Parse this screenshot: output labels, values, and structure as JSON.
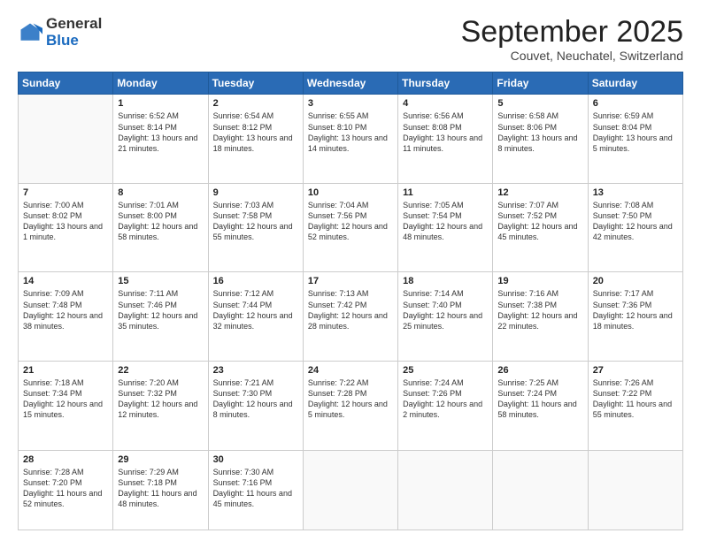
{
  "logo": {
    "general": "General",
    "blue": "Blue"
  },
  "title": "September 2025",
  "subtitle": "Couvet, Neuchatel, Switzerland",
  "weekdays": [
    "Sunday",
    "Monday",
    "Tuesday",
    "Wednesday",
    "Thursday",
    "Friday",
    "Saturday"
  ],
  "weeks": [
    [
      {
        "num": "",
        "info": ""
      },
      {
        "num": "1",
        "info": "Sunrise: 6:52 AM\nSunset: 8:14 PM\nDaylight: 13 hours\nand 21 minutes."
      },
      {
        "num": "2",
        "info": "Sunrise: 6:54 AM\nSunset: 8:12 PM\nDaylight: 13 hours\nand 18 minutes."
      },
      {
        "num": "3",
        "info": "Sunrise: 6:55 AM\nSunset: 8:10 PM\nDaylight: 13 hours\nand 14 minutes."
      },
      {
        "num": "4",
        "info": "Sunrise: 6:56 AM\nSunset: 8:08 PM\nDaylight: 13 hours\nand 11 minutes."
      },
      {
        "num": "5",
        "info": "Sunrise: 6:58 AM\nSunset: 8:06 PM\nDaylight: 13 hours\nand 8 minutes."
      },
      {
        "num": "6",
        "info": "Sunrise: 6:59 AM\nSunset: 8:04 PM\nDaylight: 13 hours\nand 5 minutes."
      }
    ],
    [
      {
        "num": "7",
        "info": "Sunrise: 7:00 AM\nSunset: 8:02 PM\nDaylight: 13 hours\nand 1 minute."
      },
      {
        "num": "8",
        "info": "Sunrise: 7:01 AM\nSunset: 8:00 PM\nDaylight: 12 hours\nand 58 minutes."
      },
      {
        "num": "9",
        "info": "Sunrise: 7:03 AM\nSunset: 7:58 PM\nDaylight: 12 hours\nand 55 minutes."
      },
      {
        "num": "10",
        "info": "Sunrise: 7:04 AM\nSunset: 7:56 PM\nDaylight: 12 hours\nand 52 minutes."
      },
      {
        "num": "11",
        "info": "Sunrise: 7:05 AM\nSunset: 7:54 PM\nDaylight: 12 hours\nand 48 minutes."
      },
      {
        "num": "12",
        "info": "Sunrise: 7:07 AM\nSunset: 7:52 PM\nDaylight: 12 hours\nand 45 minutes."
      },
      {
        "num": "13",
        "info": "Sunrise: 7:08 AM\nSunset: 7:50 PM\nDaylight: 12 hours\nand 42 minutes."
      }
    ],
    [
      {
        "num": "14",
        "info": "Sunrise: 7:09 AM\nSunset: 7:48 PM\nDaylight: 12 hours\nand 38 minutes."
      },
      {
        "num": "15",
        "info": "Sunrise: 7:11 AM\nSunset: 7:46 PM\nDaylight: 12 hours\nand 35 minutes."
      },
      {
        "num": "16",
        "info": "Sunrise: 7:12 AM\nSunset: 7:44 PM\nDaylight: 12 hours\nand 32 minutes."
      },
      {
        "num": "17",
        "info": "Sunrise: 7:13 AM\nSunset: 7:42 PM\nDaylight: 12 hours\nand 28 minutes."
      },
      {
        "num": "18",
        "info": "Sunrise: 7:14 AM\nSunset: 7:40 PM\nDaylight: 12 hours\nand 25 minutes."
      },
      {
        "num": "19",
        "info": "Sunrise: 7:16 AM\nSunset: 7:38 PM\nDaylight: 12 hours\nand 22 minutes."
      },
      {
        "num": "20",
        "info": "Sunrise: 7:17 AM\nSunset: 7:36 PM\nDaylight: 12 hours\nand 18 minutes."
      }
    ],
    [
      {
        "num": "21",
        "info": "Sunrise: 7:18 AM\nSunset: 7:34 PM\nDaylight: 12 hours\nand 15 minutes."
      },
      {
        "num": "22",
        "info": "Sunrise: 7:20 AM\nSunset: 7:32 PM\nDaylight: 12 hours\nand 12 minutes."
      },
      {
        "num": "23",
        "info": "Sunrise: 7:21 AM\nSunset: 7:30 PM\nDaylight: 12 hours\nand 8 minutes."
      },
      {
        "num": "24",
        "info": "Sunrise: 7:22 AM\nSunset: 7:28 PM\nDaylight: 12 hours\nand 5 minutes."
      },
      {
        "num": "25",
        "info": "Sunrise: 7:24 AM\nSunset: 7:26 PM\nDaylight: 12 hours\nand 2 minutes."
      },
      {
        "num": "26",
        "info": "Sunrise: 7:25 AM\nSunset: 7:24 PM\nDaylight: 11 hours\nand 58 minutes."
      },
      {
        "num": "27",
        "info": "Sunrise: 7:26 AM\nSunset: 7:22 PM\nDaylight: 11 hours\nand 55 minutes."
      }
    ],
    [
      {
        "num": "28",
        "info": "Sunrise: 7:28 AM\nSunset: 7:20 PM\nDaylight: 11 hours\nand 52 minutes."
      },
      {
        "num": "29",
        "info": "Sunrise: 7:29 AM\nSunset: 7:18 PM\nDaylight: 11 hours\nand 48 minutes."
      },
      {
        "num": "30",
        "info": "Sunrise: 7:30 AM\nSunset: 7:16 PM\nDaylight: 11 hours\nand 45 minutes."
      },
      {
        "num": "",
        "info": ""
      },
      {
        "num": "",
        "info": ""
      },
      {
        "num": "",
        "info": ""
      },
      {
        "num": "",
        "info": ""
      }
    ]
  ]
}
